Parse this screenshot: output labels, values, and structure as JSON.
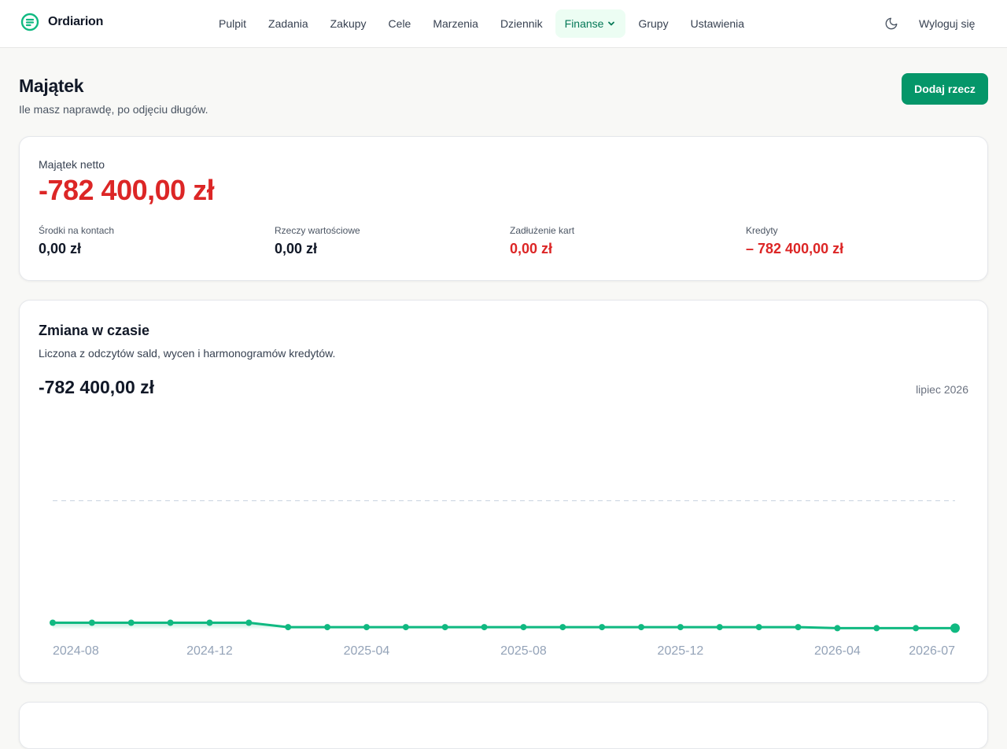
{
  "app": {
    "name": "Ordiarion",
    "logo_icon": "ordiarion-logo-icon"
  },
  "nav": {
    "items": [
      {
        "label": "Pulpit",
        "active": false
      },
      {
        "label": "Zadania",
        "active": false
      },
      {
        "label": "Zakupy",
        "active": false
      },
      {
        "label": "Cele",
        "active": false
      },
      {
        "label": "Marzenia",
        "active": false
      },
      {
        "label": "Dziennik",
        "active": false
      },
      {
        "label": "Finanse",
        "active": true,
        "has_dropdown": true
      },
      {
        "label": "Grupy",
        "active": false
      },
      {
        "label": "Ustawienia",
        "active": false
      }
    ],
    "theme_icon": "moon-icon",
    "logout_label": "Wyloguj się"
  },
  "page": {
    "title": "Majątek",
    "subtitle": "Ile masz naprawdę, po odjęciu długów.",
    "add_button_label": "Dodaj rzecz"
  },
  "net_worth": {
    "label": "Majątek netto",
    "value": "-782 400,00 zł",
    "stats": [
      {
        "label": "Środki na kontach",
        "value": "0,00 zł",
        "negative": false
      },
      {
        "label": "Rzeczy wartościowe",
        "value": "0,00 zł",
        "negative": false
      },
      {
        "label": "Zadłużenie kart",
        "value": "0,00 zł",
        "negative": true
      },
      {
        "label": "Kredyty",
        "value": "– 782 400,00 zł",
        "negative": true
      }
    ]
  },
  "history": {
    "title": "Zmiana w czasie",
    "subtitle": "Liczona z odczytów sald, wycen i harmonogramów kredytów.",
    "current_value": "-782 400,00 zł",
    "current_period": "lipiec 2026"
  },
  "chart_data": {
    "type": "area",
    "x": [
      "2024-08",
      "2024-09",
      "2024-10",
      "2024-11",
      "2024-12",
      "2025-01",
      "2025-02",
      "2025-03",
      "2025-04",
      "2025-05",
      "2025-06",
      "2025-07",
      "2025-08",
      "2025-09",
      "2025-10",
      "2025-11",
      "2025-12",
      "2026-01",
      "2026-02",
      "2026-03",
      "2026-04",
      "2026-05",
      "2026-06",
      "2026-07"
    ],
    "series": [
      {
        "values": [
          -749000,
          -749000,
          -749000,
          -749000,
          -749000,
          -749000,
          -776000,
          -776000,
          -776000,
          -776000,
          -776000,
          -776000,
          -776000,
          -776000,
          -776000,
          -776000,
          -776000,
          -776000,
          -776000,
          -776000,
          -782400,
          -782400,
          -782400,
          -782400
        ]
      }
    ],
    "tick_labels": [
      "2024-08",
      "2024-12",
      "2025-04",
      "2025-08",
      "2025-12",
      "2026-04",
      "2026-07"
    ],
    "reference_line": 0,
    "ylim": [
      -790000,
      350000
    ],
    "color": "#10b981",
    "grid": false,
    "legend": "none"
  },
  "colors": {
    "accent": "#059669",
    "negative": "#dc2626",
    "line": "#10b981"
  }
}
